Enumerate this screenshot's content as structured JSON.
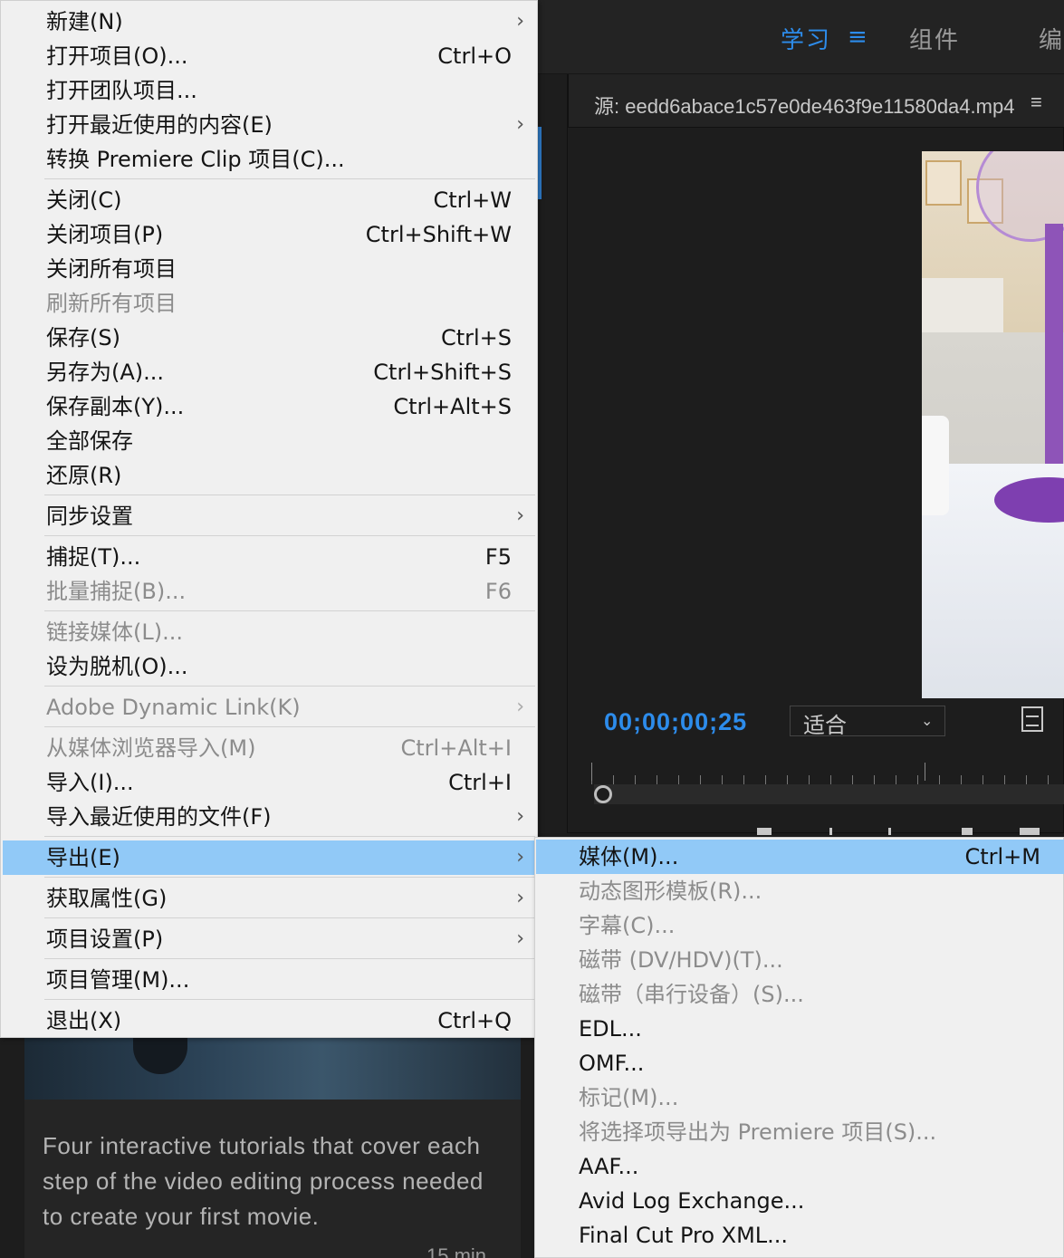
{
  "workspace_tabs": {
    "learn": "学习",
    "learn_menu_glyph": "≡",
    "assembly": "组件",
    "edit": "编"
  },
  "source_monitor": {
    "title": "源: eedd6abace1c57e0de463f9e11580da4.mp4",
    "menu_glyph": "≡",
    "timecode": "00;00;00;25",
    "fit_value": "适合",
    "fit_chevron": "⌄"
  },
  "learn_panel": {
    "description": "Four interactive tutorials that cover each step of the video editing process needed to create your first movie.",
    "duration": "15 min"
  },
  "file_menu": {
    "items": [
      {
        "label": "新建(N)",
        "shortcut": "",
        "submenu": true,
        "disabled": false
      },
      {
        "label": "打开项目(O)...",
        "shortcut": "Ctrl+O",
        "submenu": false,
        "disabled": false
      },
      {
        "label": "打开团队项目...",
        "shortcut": "",
        "submenu": false,
        "disabled": false
      },
      {
        "label": "打开最近使用的内容(E)",
        "shortcut": "",
        "submenu": true,
        "disabled": false
      },
      {
        "label": "转换 Premiere Clip 项目(C)...",
        "shortcut": "",
        "submenu": false,
        "disabled": false
      },
      {
        "label": "关闭(C)",
        "shortcut": "Ctrl+W",
        "submenu": false,
        "disabled": false
      },
      {
        "label": "关闭项目(P)",
        "shortcut": "Ctrl+Shift+W",
        "submenu": false,
        "disabled": false
      },
      {
        "label": "关闭所有项目",
        "shortcut": "",
        "submenu": false,
        "disabled": false
      },
      {
        "label": "刷新所有项目",
        "shortcut": "",
        "submenu": false,
        "disabled": true
      },
      {
        "label": "保存(S)",
        "shortcut": "Ctrl+S",
        "submenu": false,
        "disabled": false
      },
      {
        "label": "另存为(A)...",
        "shortcut": "Ctrl+Shift+S",
        "submenu": false,
        "disabled": false
      },
      {
        "label": "保存副本(Y)...",
        "shortcut": "Ctrl+Alt+S",
        "submenu": false,
        "disabled": false
      },
      {
        "label": "全部保存",
        "shortcut": "",
        "submenu": false,
        "disabled": false
      },
      {
        "label": "还原(R)",
        "shortcut": "",
        "submenu": false,
        "disabled": false
      },
      {
        "label": "同步设置",
        "shortcut": "",
        "submenu": true,
        "disabled": false
      },
      {
        "label": "捕捉(T)...",
        "shortcut": "F5",
        "submenu": false,
        "disabled": false
      },
      {
        "label": "批量捕捉(B)...",
        "shortcut": "F6",
        "submenu": false,
        "disabled": true
      },
      {
        "label": "链接媒体(L)...",
        "shortcut": "",
        "submenu": false,
        "disabled": true
      },
      {
        "label": "设为脱机(O)...",
        "shortcut": "",
        "submenu": false,
        "disabled": false
      },
      {
        "label": "Adobe Dynamic Link(K)",
        "shortcut": "",
        "submenu": true,
        "disabled": true
      },
      {
        "label": "从媒体浏览器导入(M)",
        "shortcut": "Ctrl+Alt+I",
        "submenu": false,
        "disabled": true
      },
      {
        "label": "导入(I)...",
        "shortcut": "Ctrl+I",
        "submenu": false,
        "disabled": false
      },
      {
        "label": "导入最近使用的文件(F)",
        "shortcut": "",
        "submenu": true,
        "disabled": false
      },
      {
        "label": "导出(E)",
        "shortcut": "",
        "submenu": true,
        "disabled": false,
        "highlighted": true
      },
      {
        "label": "获取属性(G)",
        "shortcut": "",
        "submenu": true,
        "disabled": false
      },
      {
        "label": "项目设置(P)",
        "shortcut": "",
        "submenu": true,
        "disabled": false
      },
      {
        "label": "项目管理(M)...",
        "shortcut": "",
        "submenu": false,
        "disabled": false
      },
      {
        "label": "退出(X)",
        "shortcut": "Ctrl+Q",
        "submenu": false,
        "disabled": false
      }
    ]
  },
  "export_submenu": {
    "items": [
      {
        "label": "媒体(M)...",
        "shortcut": "Ctrl+M",
        "disabled": false,
        "highlighted": true
      },
      {
        "label": "动态图形模板(R)...",
        "shortcut": "",
        "disabled": true
      },
      {
        "label": "字幕(C)...",
        "shortcut": "",
        "disabled": true
      },
      {
        "label": "磁带 (DV/HDV)(T)...",
        "shortcut": "",
        "disabled": true
      },
      {
        "label": "磁带（串行设备）(S)...",
        "shortcut": "",
        "disabled": true
      },
      {
        "label": "EDL...",
        "shortcut": "",
        "disabled": false
      },
      {
        "label": "OMF...",
        "shortcut": "",
        "disabled": false
      },
      {
        "label": "标记(M)...",
        "shortcut": "",
        "disabled": true
      },
      {
        "label": "将选择项导出为 Premiere 项目(S)...",
        "shortcut": "",
        "disabled": true
      },
      {
        "label": "AAF...",
        "shortcut": "",
        "disabled": false
      },
      {
        "label": "Avid Log Exchange...",
        "shortcut": "",
        "disabled": false
      },
      {
        "label": "Final Cut Pro XML...",
        "shortcut": "",
        "disabled": false
      }
    ]
  },
  "colors": {
    "accent": "#2d8ceb",
    "menu_bg": "#f0f0f0",
    "menu_highlight": "#91c9f7",
    "disabled_text": "#8c8c8c"
  }
}
